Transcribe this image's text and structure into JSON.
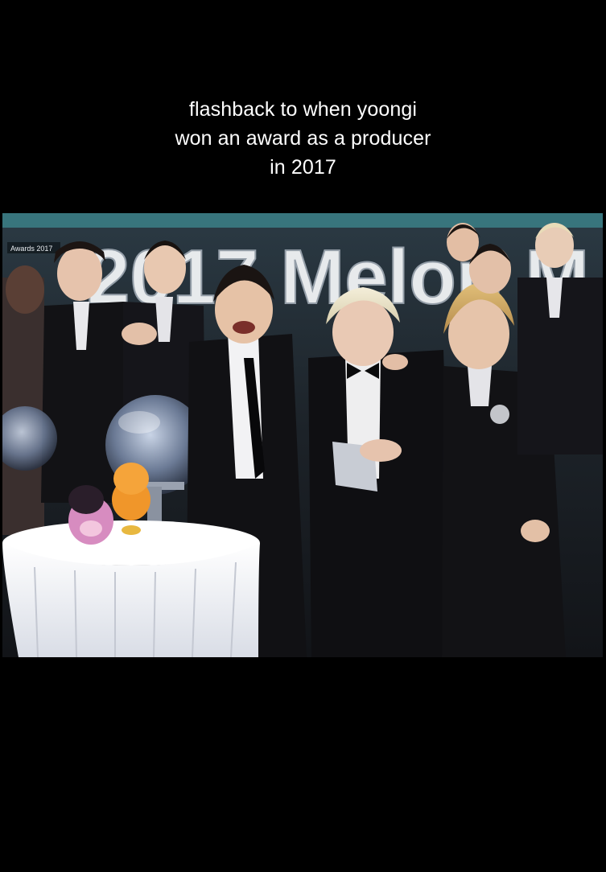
{
  "caption": {
    "lines": [
      "flashback to when yoongi",
      "won an award as a producer",
      "in 2017"
    ]
  },
  "video": {
    "backdrop_text": "2017 Melon M",
    "corner_label": "Awards 2017"
  },
  "colors": {
    "background": "#000000",
    "caption_text": "#ffffff"
  }
}
